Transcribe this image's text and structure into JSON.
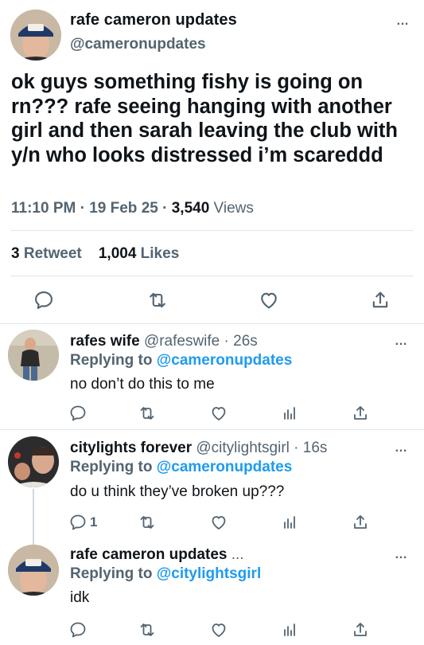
{
  "main_tweet": {
    "name": "rafe cameron updates",
    "handle": "@cameronupdates",
    "text": "ok guys something fishy is going on rn??? rafe seeing hanging with another girl and then sarah leaving the club with y/n who looks distressed i’m scareddd",
    "time": "11:10 PM",
    "date": "19 Feb 25",
    "views_count": "3,540",
    "views_label": "Views",
    "retweet_count": "3",
    "retweet_label": "Retweet",
    "likes_count": "1,004",
    "likes_label": "Likes",
    "more": "…"
  },
  "replies": [
    {
      "name": "rafes wife",
      "handle": "@rafeswife",
      "time": "26s",
      "replying_prefix": "Replying to",
      "replying_to": "@cameronupdates",
      "text": "no don’t do this to me",
      "reply_count": "",
      "more": "…"
    },
    {
      "name": "citylights forever",
      "handle": "@citylightsgirl",
      "time": "16s",
      "replying_prefix": "Replying to",
      "replying_to": "@cameronupdates",
      "text": "do u think they’ve broken up???",
      "reply_count": "1",
      "more": "…"
    },
    {
      "name": "rafe cameron updates",
      "handle": "...",
      "time": "",
      "replying_prefix": "Replying to",
      "replying_to": "@citylightsgirl",
      "text": "idk",
      "reply_count": "",
      "more": "…"
    }
  ],
  "separator": "·",
  "colors": {
    "text": "#0f1419",
    "secondary": "#536471",
    "accent": "#1d9bf0",
    "divider": "#e1e6ea"
  },
  "icons": [
    "reply-icon",
    "retweet-icon",
    "like-icon",
    "share-icon",
    "views-icon",
    "more-icon"
  ]
}
